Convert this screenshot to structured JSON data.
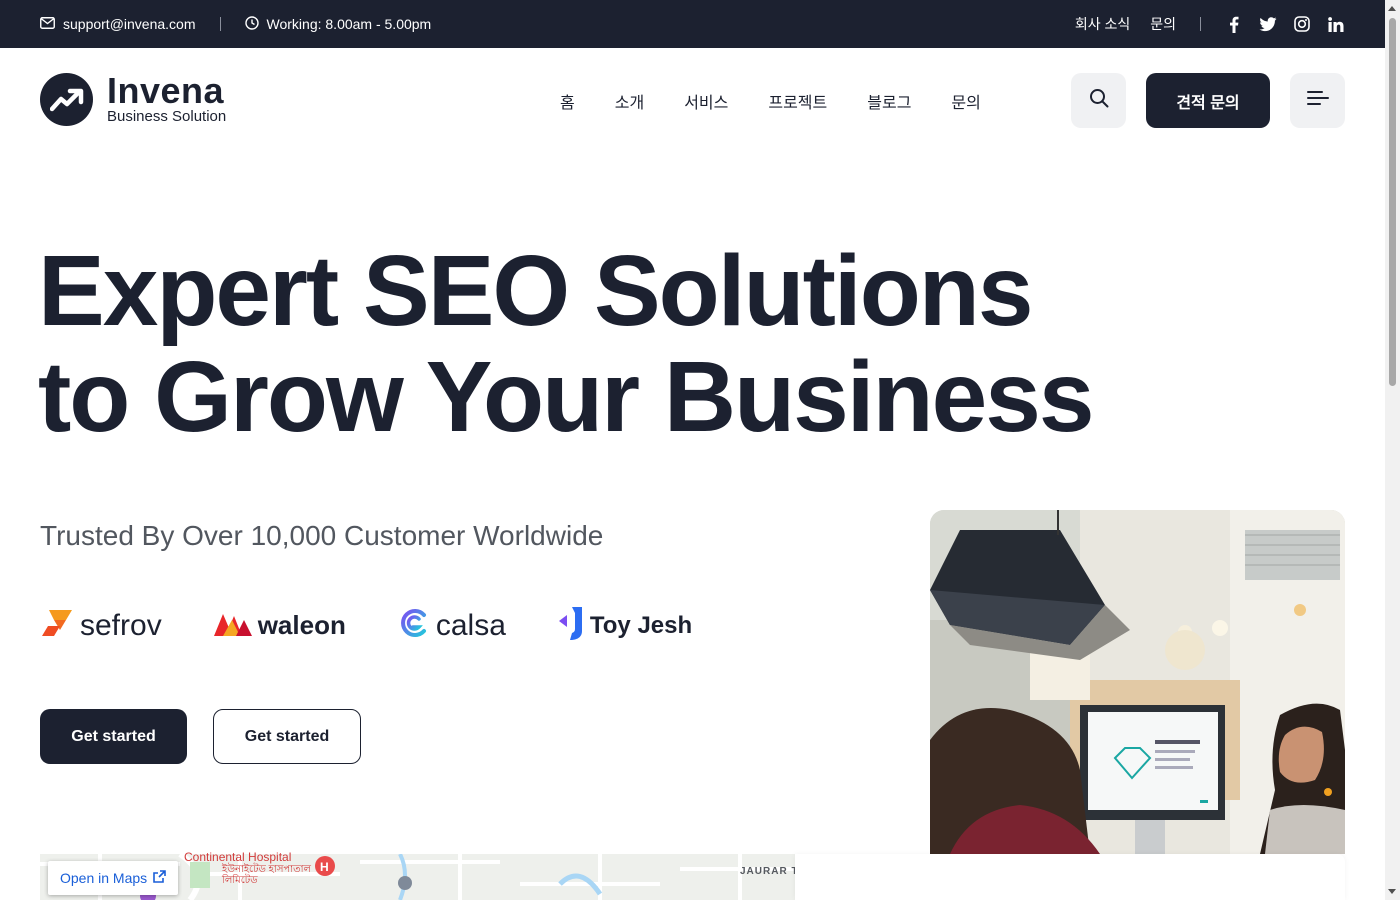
{
  "topbar": {
    "email": "support@invena.com",
    "hours": "Working: 8.00am - 5.00pm",
    "links": [
      "회사 소식",
      "문의"
    ],
    "social": [
      "facebook-icon",
      "twitter-icon",
      "instagram-icon",
      "linkedin-icon"
    ]
  },
  "header": {
    "logo_name": "Invena",
    "logo_tag": "Business Solution",
    "nav": [
      "홈",
      "소개",
      "서비스",
      "프로젝트",
      "블로그",
      "문의"
    ],
    "quote_button": "견적 문의"
  },
  "hero": {
    "title_line1": "Expert SEO Solutions",
    "title_line2": "to Grow Your Business",
    "trusted": "Trusted By Over 10,000 Customer Worldwide",
    "brands": [
      "sefrov",
      "waleon",
      "calsa",
      "Toy Jesh"
    ],
    "cta_primary": "Get started",
    "cta_secondary": "Get started"
  },
  "map": {
    "open_label": "Open in Maps",
    "place1": "Continental Hospital",
    "place1_local": "ইউনাইটেড হাসপাতাল লিমিটেড",
    "place2": "JAURAR TI"
  },
  "colors": {
    "primary": "#1c2130",
    "map_link": "#1a5fd8"
  }
}
